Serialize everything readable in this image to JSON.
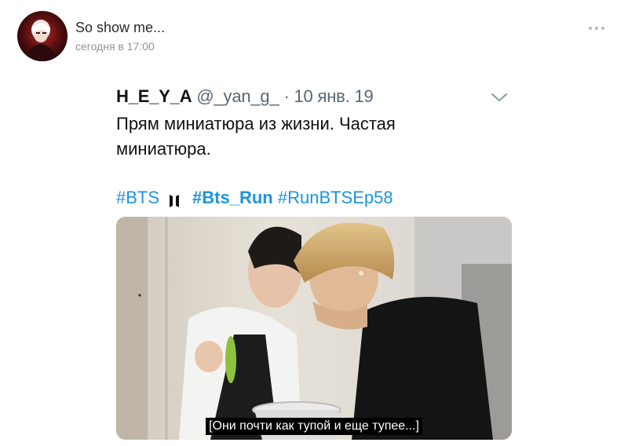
{
  "post": {
    "author_name": "So show me...",
    "time": "сегодня в 17:00",
    "avatar_icon": "profile-photo",
    "menu_icon": "more-dots-icon"
  },
  "tweet": {
    "name": "H_E_Y_A",
    "handle": "@_yan_g_",
    "separator": "·",
    "date": "10 янв. 19",
    "text": "Прям миниатюра из жизни. Частая миниатюра.",
    "hashtags": {
      "bts": "#BTS",
      "bts_run": "#Bts_Run",
      "run_ep": "#RunBTSEp58"
    },
    "hashtag_color": "#1b95e0",
    "chevron_icon": "chevron-down-icon",
    "media": {
      "subtitle": "[Они почти как тупой и еще тупее...]"
    }
  }
}
